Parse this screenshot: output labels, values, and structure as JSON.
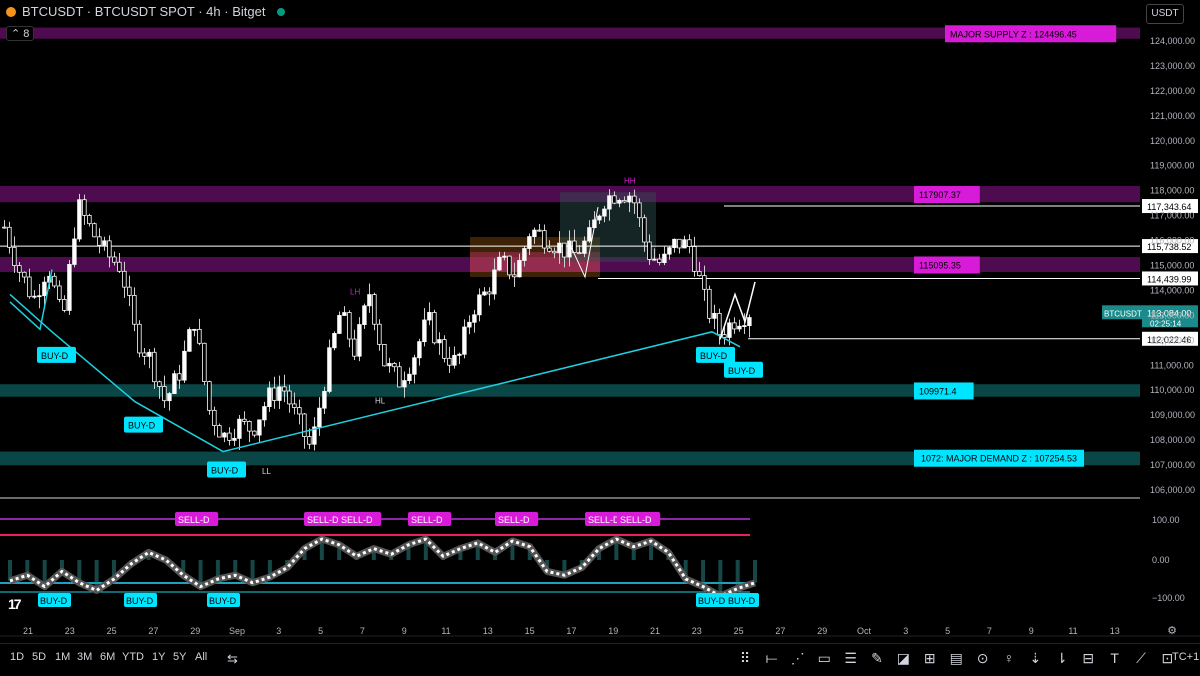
{
  "header": {
    "title": "BTCUSDT · BTCUSDT SPOT · 4h · Bitget",
    "indicator_count": "8",
    "currency": "USDT"
  },
  "chart_data": {
    "type": "candlestick",
    "symbol": "BTCUSDT",
    "interval": "4h",
    "exchange": "Bitget",
    "price_axis": {
      "min": 106000,
      "max": 124000,
      "ticks": [
        "124,000.00",
        "123,000.00",
        "122,000.00",
        "121,000.00",
        "120,000.00",
        "119,000.00",
        "118,000.00",
        "117,000.00",
        "116,000.00",
        "115,000.00",
        "114,000.00",
        "113,000.00",
        "112,000.00",
        "111,000.00",
        "110,000.00",
        "109,000.00",
        "108,000.00",
        "107,000.00",
        "106,000.00"
      ]
    },
    "x_labels": [
      "21",
      "23",
      "25",
      "27",
      "29",
      "Sep",
      "3",
      "5",
      "7",
      "9",
      "11",
      "13",
      "15",
      "17",
      "19",
      "21",
      "23",
      "25",
      "27",
      "29",
      "Oct",
      "3",
      "5",
      "7",
      "9",
      "11",
      "13"
    ],
    "price_path": [
      116500,
      114800,
      113600,
      115000,
      112600,
      117400,
      116300,
      115400,
      114900,
      112100,
      111200,
      109500,
      110700,
      112800,
      109200,
      108100,
      108600,
      108400,
      109600,
      110200,
      108800,
      107600,
      110600,
      113100,
      111500,
      113900,
      111100,
      110300,
      111300,
      112800,
      111500,
      111000,
      113200,
      113900,
      115100,
      114600,
      116400,
      116100,
      115700,
      115400,
      116000,
      117600,
      117900,
      117800,
      115500,
      115000,
      115900,
      115700,
      113400,
      112200,
      112800,
      113100
    ],
    "zones": [
      {
        "label": "MAJOR SUPPLY Z : 124496.45",
        "color": "#d81bd8"
      },
      {
        "label": "117907.37",
        "color": "#d81bd8"
      },
      {
        "label": "115095.35",
        "color": "#d81bd8"
      },
      {
        "label": "109971.4",
        "color": "#00e5ff"
      },
      {
        "label": "107254.53",
        "text": "MAJOR DEMAND Z : 107254.53",
        "color": "#00e5ff"
      }
    ],
    "price_tags": [
      "117,343.64",
      "115,738.52",
      "114,439.99",
      "112,022.46"
    ],
    "last_price": {
      "symbol": "BTCUSDT",
      "price": "113,084.00",
      "countdown": "02:25:14"
    },
    "structure_labels": [
      "LH",
      "HL",
      "LL",
      "HH"
    ],
    "buy_signals": [
      "BUY-D",
      "BUY-D",
      "BUY-D",
      "BUY-D",
      "BUY-D"
    ],
    "oscillator": {
      "ticks": [
        "100.00",
        "0.00",
        "−100.00"
      ],
      "sell_signals": [
        "SELL-D",
        "SELL-D",
        "SELL-D",
        "SELL-D",
        "SELL-D",
        "SELL-D",
        "SELL-D"
      ],
      "buy_signals": [
        "BUY-D",
        "BUY-D",
        "BUY-D",
        "BUY-D",
        "BUY-D"
      ],
      "values": [
        -55,
        -40,
        -70,
        -30,
        -60,
        -80,
        -50,
        -10,
        20,
        0,
        -40,
        -70,
        -50,
        -40,
        -60,
        -45,
        -20,
        30,
        55,
        40,
        10,
        30,
        15,
        40,
        55,
        10,
        30,
        45,
        20,
        50,
        35,
        -30,
        -40,
        -20,
        30,
        55,
        35,
        50,
        20,
        -50,
        -70,
        -95,
        -75,
        -60
      ]
    }
  },
  "timeframes": [
    "1D",
    "5D",
    "1M",
    "3M",
    "6M",
    "YTD",
    "1Y",
    "5Y",
    "All"
  ],
  "tools_suffix": "TC+1"
}
